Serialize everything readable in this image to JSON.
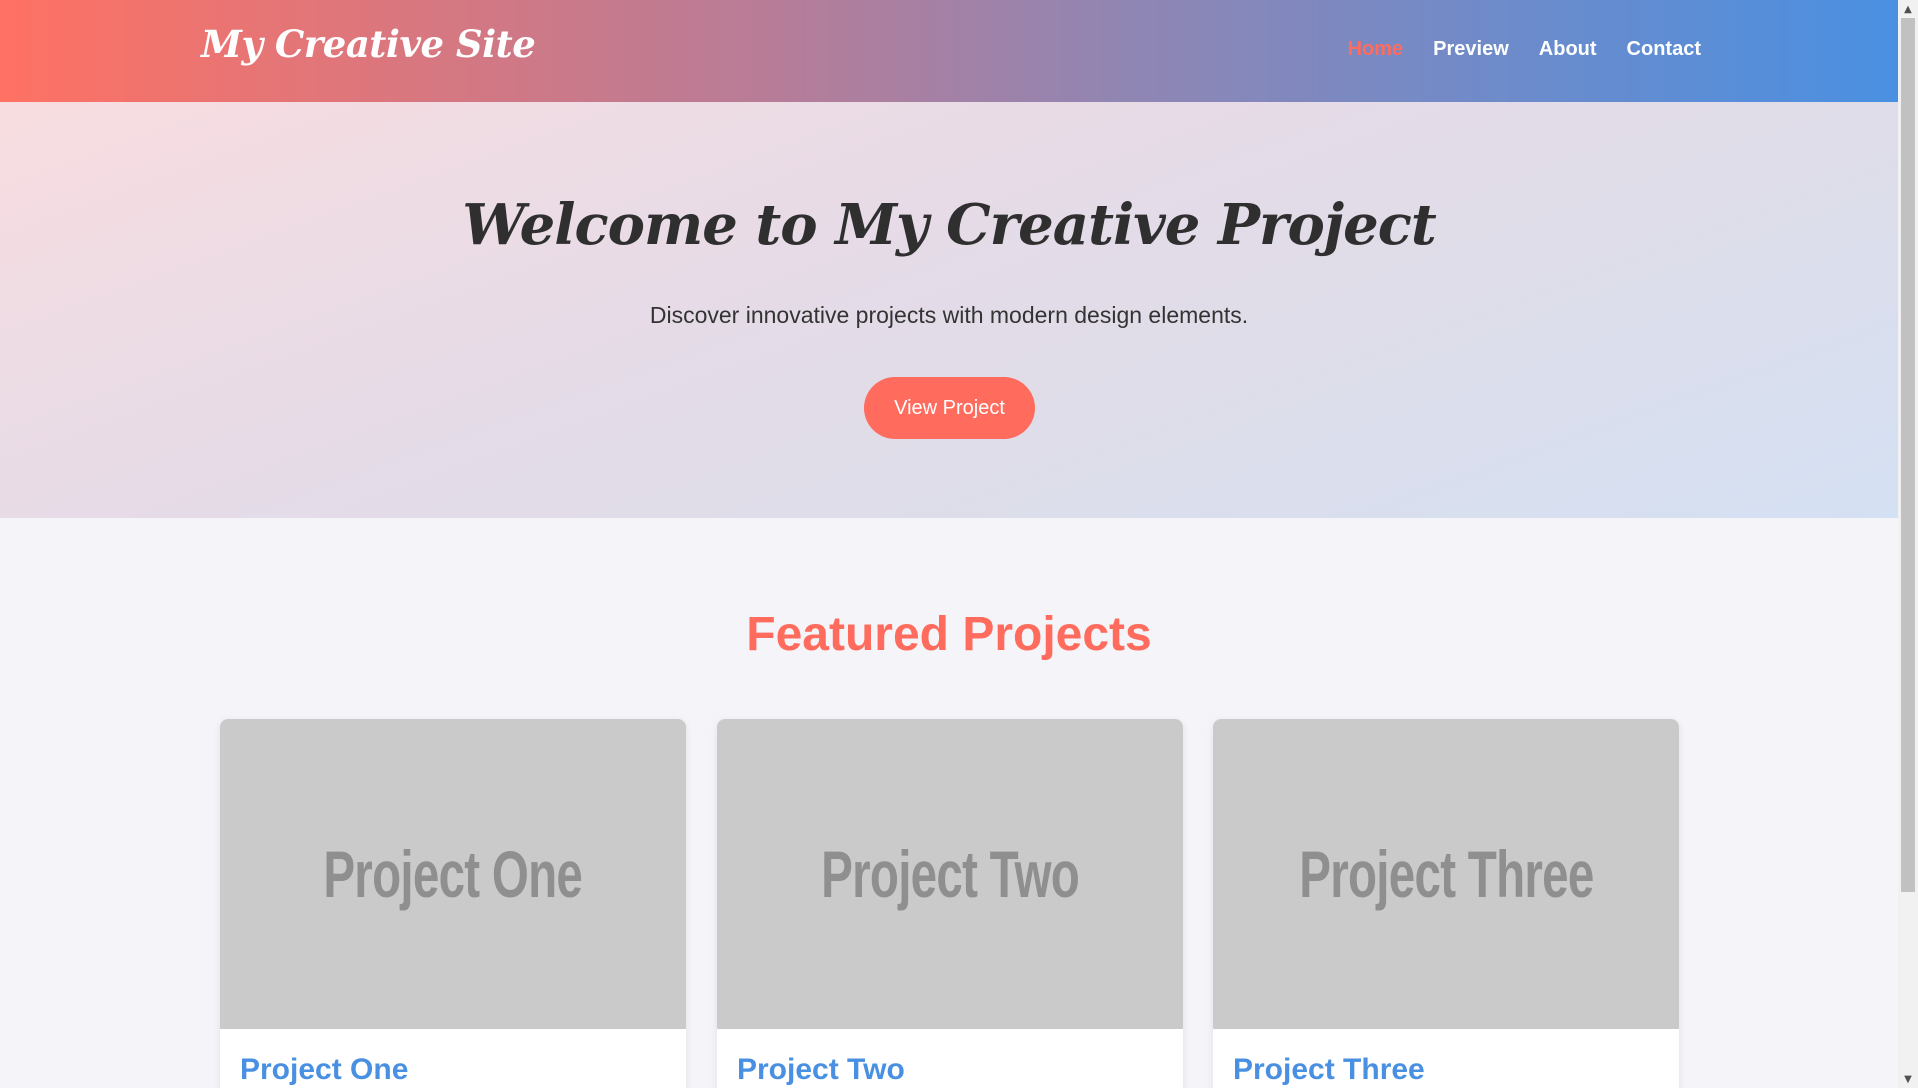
{
  "header": {
    "logo": "My Creative Site",
    "nav": [
      {
        "label": "Home",
        "active": true
      },
      {
        "label": "Preview",
        "active": false
      },
      {
        "label": "About",
        "active": false
      },
      {
        "label": "Contact",
        "active": false
      }
    ]
  },
  "hero": {
    "title": "Welcome to My Creative Project",
    "subtitle": "Discover innovative projects with modern design elements.",
    "button_label": "View Project"
  },
  "featured": {
    "title": "Featured Projects",
    "cards": [
      {
        "image_text": "Project One",
        "title": "Project One"
      },
      {
        "image_text": "Project Two",
        "title": "Project Two"
      },
      {
        "image_text": "Project Three",
        "title": "Project Three"
      }
    ]
  },
  "colors": {
    "accent": "#ff6b5c",
    "link_blue": "#4a90e2",
    "text_dark": "#2f2f2f",
    "placeholder_gray": "#cacaca"
  },
  "scrollbar": {
    "up_icon": "scroll-up-arrow-icon",
    "down_icon": "scroll-down-arrow-icon"
  }
}
